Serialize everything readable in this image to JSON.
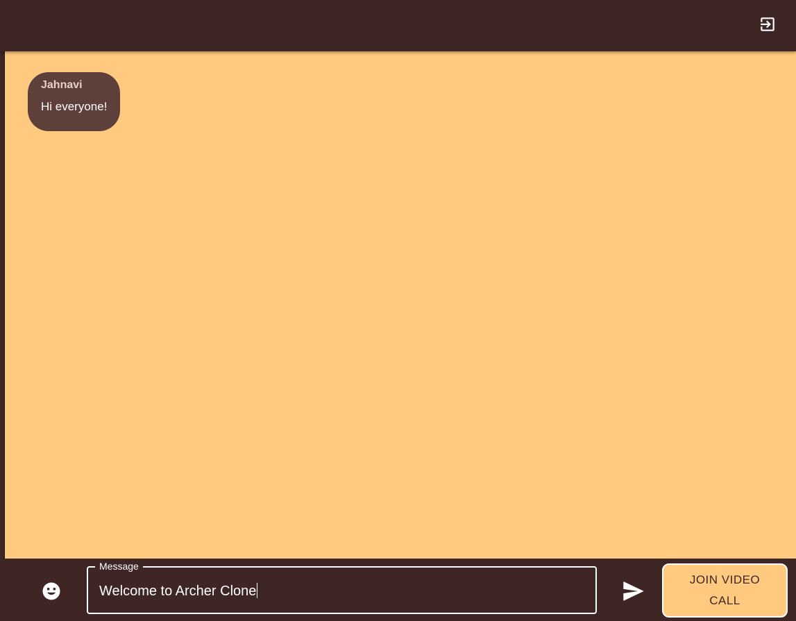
{
  "topbar": {
    "logout_icon": "logout-icon"
  },
  "chat": {
    "background_color": "#ffca7f",
    "messages": [
      {
        "sender": "Jahnavi",
        "text": "Hi everyone!"
      }
    ]
  },
  "composer": {
    "emoji_icon": "emoji-icon",
    "field_label": "Message",
    "input_value": "Welcome to Archer Clone",
    "send_icon": "send-icon",
    "video_call_label": "JOIN VIDEO CALL"
  },
  "colors": {
    "bar": "#3d2624",
    "bubble": "#5d403a",
    "accent": "#ffca7f"
  }
}
